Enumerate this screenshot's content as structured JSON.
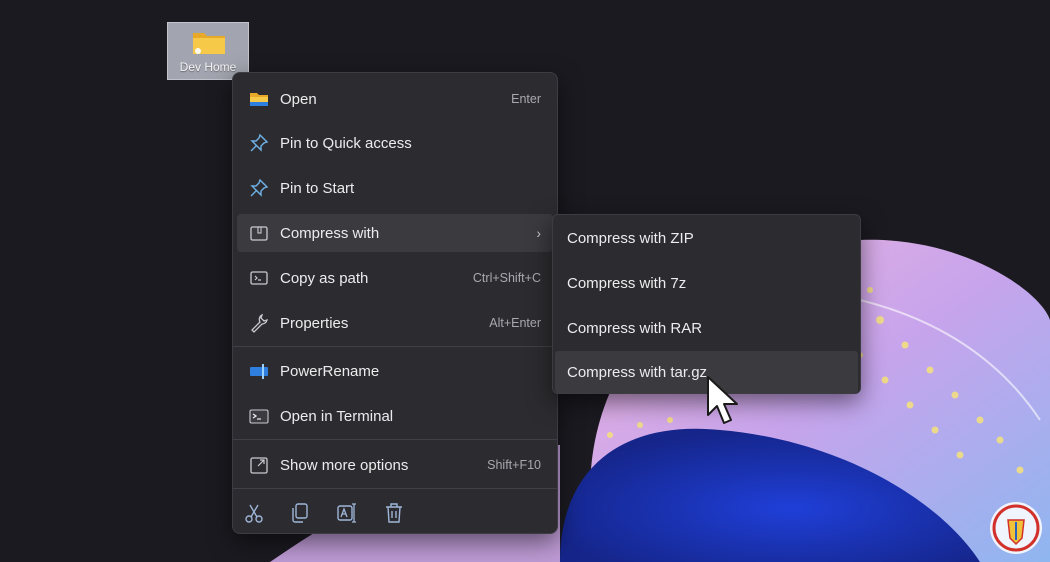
{
  "desktop": {
    "icon_label": "Dev Home",
    "icon_name": "folder-icon"
  },
  "context_menu": {
    "items": [
      {
        "label": "Open",
        "shortcut": "Enter",
        "icon": "folder-icon"
      },
      {
        "label": "Pin to Quick access",
        "shortcut": "",
        "icon": "pin-icon"
      },
      {
        "label": "Pin to Start",
        "shortcut": "",
        "icon": "pin-icon"
      },
      {
        "label": "Compress with",
        "shortcut": "",
        "icon": "archive-icon",
        "has_submenu": true,
        "highlighted": true
      },
      {
        "label": "Copy as path",
        "shortcut": "Ctrl+Shift+C",
        "icon": "copy-path-icon"
      },
      {
        "label": "Properties",
        "shortcut": "Alt+Enter",
        "icon": "wrench-icon"
      },
      {
        "label": "PowerRename",
        "shortcut": "",
        "icon": "powerrename-icon"
      },
      {
        "label": "Open in Terminal",
        "shortcut": "",
        "icon": "terminal-icon"
      },
      {
        "label": "Show more options",
        "shortcut": "Shift+F10",
        "icon": "expand-icon"
      }
    ],
    "toolbar": [
      {
        "icon": "cut-icon"
      },
      {
        "icon": "copy-icon"
      },
      {
        "icon": "rename-icon"
      },
      {
        "icon": "delete-icon"
      }
    ]
  },
  "submenu": {
    "items": [
      {
        "label": "Compress with ZIP"
      },
      {
        "label": "Compress with 7z"
      },
      {
        "label": "Compress with RAR"
      },
      {
        "label": "Compress with tar.gz",
        "highlighted": true
      }
    ]
  },
  "colors": {
    "background": "#1b1a20",
    "menu": "#2c2c30",
    "highlight": "#3a3a3f",
    "folder_yellow": "#f3c43a",
    "accent_blue": "#1f4fd0",
    "wallpaper_pink": "#e7a8de"
  }
}
